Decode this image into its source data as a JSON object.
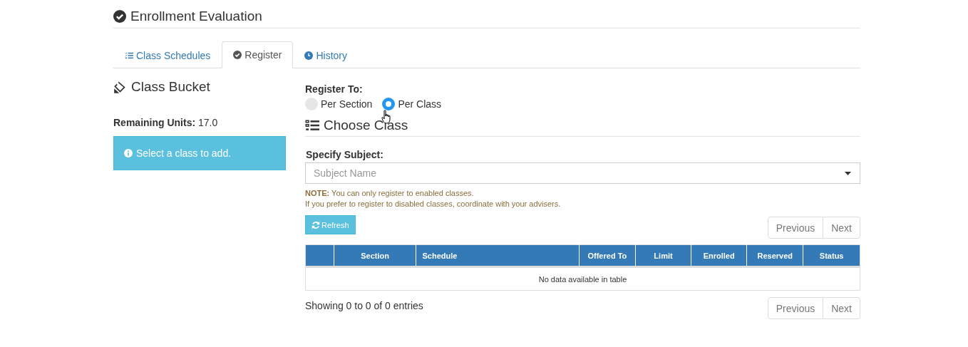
{
  "page_title": "Enrollment Evaluation",
  "tabs": [
    {
      "label": "Class Schedules",
      "selected": false
    },
    {
      "label": "Register",
      "selected": true
    },
    {
      "label": "History",
      "selected": false
    }
  ],
  "class_bucket": {
    "title": "Class Bucket",
    "remaining_label": "Remaining Units:",
    "remaining_value": "17.0",
    "alert": "Select a class to add."
  },
  "register_to": {
    "label": "Register To:",
    "options": [
      {
        "label": "Per Section",
        "selected": false
      },
      {
        "label": "Per Class",
        "selected": true
      }
    ]
  },
  "choose_class": {
    "title": "Choose Class",
    "subject_label": "Specify Subject:",
    "subject_placeholder": "Subject Name",
    "notes": [
      "**NOTE:** You can only register to enabled classes.",
      "If you prefer to register to disabled classes, coordinate with your advisers."
    ],
    "refresh_button": "Refresh"
  },
  "pagination_top": [
    "Previous",
    "Next"
  ],
  "table": {
    "columns": [
      "Section",
      "Schedule",
      "Offered To",
      "Limit",
      "Enrolled",
      "Reserved",
      "Status"
    ],
    "empty_message": "No data available in table"
  },
  "info": "Showing 0 to 0 of 0 entries",
  "pagination_bottom": [
    "Previous",
    "Next"
  ]
}
